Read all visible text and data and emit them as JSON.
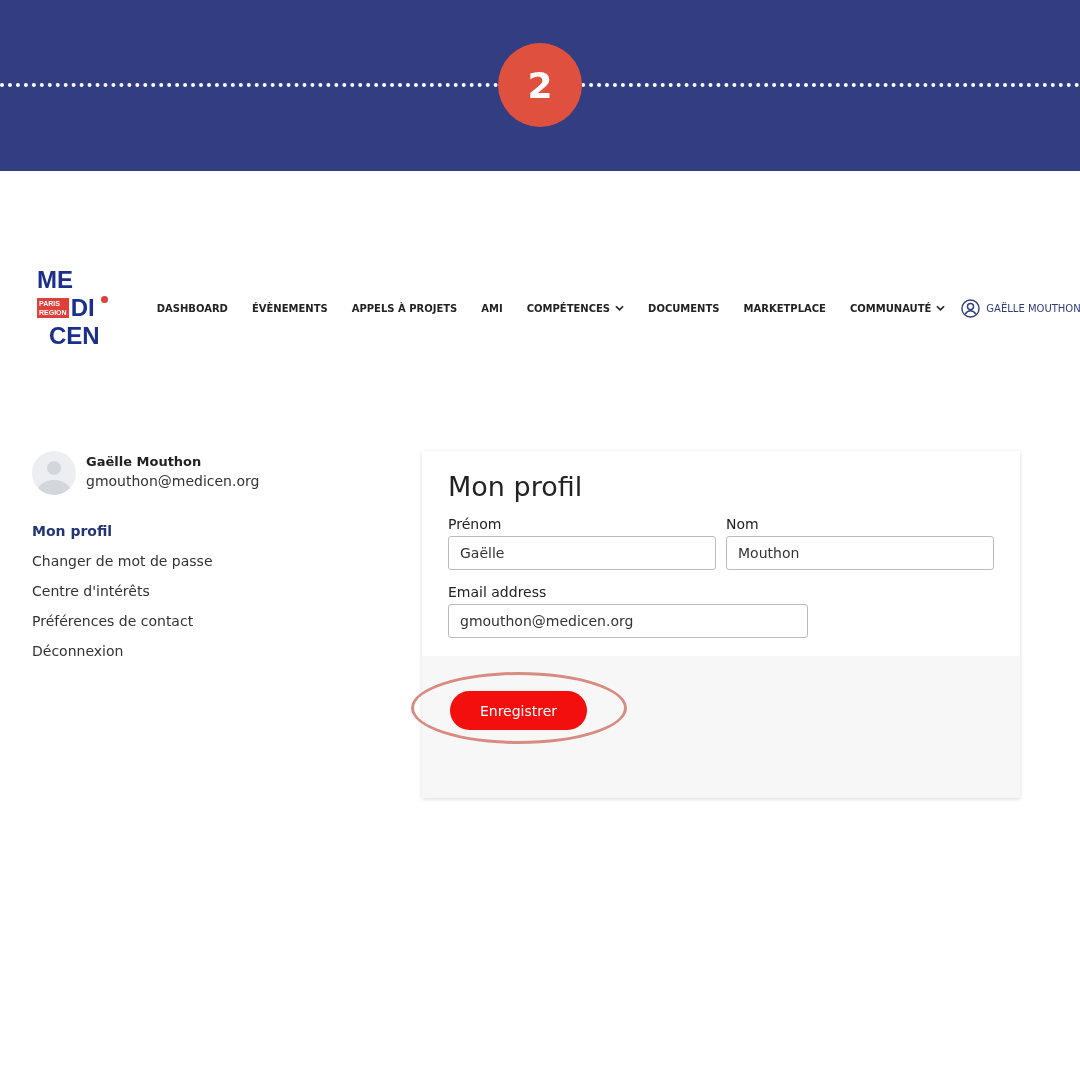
{
  "banner": {
    "step": "2"
  },
  "logo": {
    "lines": [
      "ME",
      "DI",
      "CEN"
    ],
    "badge": [
      "PARIS",
      "REGION"
    ]
  },
  "nav": {
    "items": [
      {
        "label": "DASHBOARD",
        "dropdown": false
      },
      {
        "label": "ÉVÈNEMENTS",
        "dropdown": false
      },
      {
        "label": "APPELS À PROJETS",
        "dropdown": false
      },
      {
        "label": "AMI",
        "dropdown": false
      },
      {
        "label": "COMPÉTENCES",
        "dropdown": true
      },
      {
        "label": "DOCUMENTS",
        "dropdown": false
      },
      {
        "label": "MARKETPLACE",
        "dropdown": false
      },
      {
        "label": "COMMUNAUTÉ",
        "dropdown": true
      }
    ],
    "user": "GAËLLE MOUTHON"
  },
  "sidebar": {
    "name": "Gaëlle Mouthon",
    "email": "gmouthon@medicen.org",
    "items": [
      {
        "label": "Mon profil",
        "selected": true
      },
      {
        "label": "Changer de mot de passe",
        "selected": false
      },
      {
        "label": "Centre d'intérêts",
        "selected": false
      },
      {
        "label": "Préférences de contact",
        "selected": false
      },
      {
        "label": "Déconnexion",
        "selected": false
      }
    ]
  },
  "form": {
    "title": "Mon profil",
    "rows": [
      [
        {
          "label": "Prénom",
          "value": "Gaëlle"
        },
        {
          "label": "Nom",
          "value": "Mouthon"
        }
      ],
      [
        {
          "label": "Email address",
          "value": "gmouthon@medicen.org"
        }
      ]
    ],
    "button": {
      "label": "Enregistrer",
      "highlighted": true
    }
  }
}
